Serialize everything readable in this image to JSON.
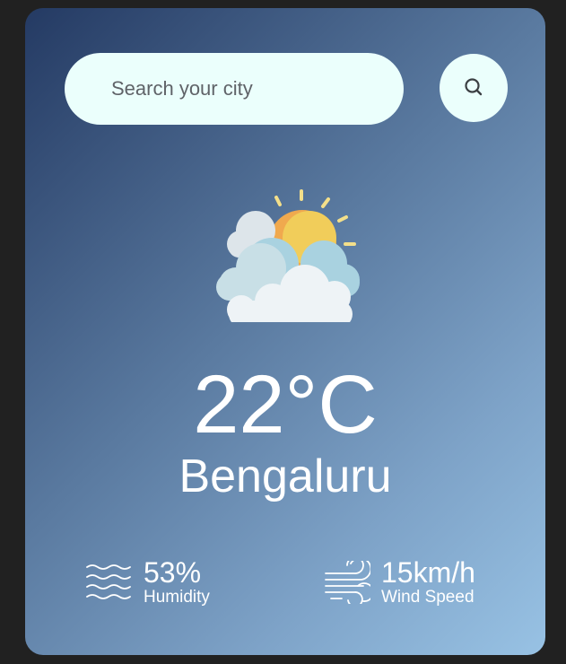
{
  "search": {
    "placeholder": "Search your city",
    "button_icon": "search-icon"
  },
  "weather": {
    "condition_icon": "partly-cloudy-sun-icon",
    "temperature": "22°C",
    "city": "Bengaluru"
  },
  "details": {
    "humidity": {
      "icon": "humidity-waves-icon",
      "value": "53%",
      "label": "Humidity"
    },
    "wind": {
      "icon": "wind-icon",
      "value": "15km/h",
      "label": "Wind Speed"
    }
  },
  "colors": {
    "page_background": "#212121",
    "card_gradient_start": "#243a63",
    "card_gradient_end": "#98c2e4",
    "input_background": "#ebfffc",
    "text": "#ffffff"
  }
}
